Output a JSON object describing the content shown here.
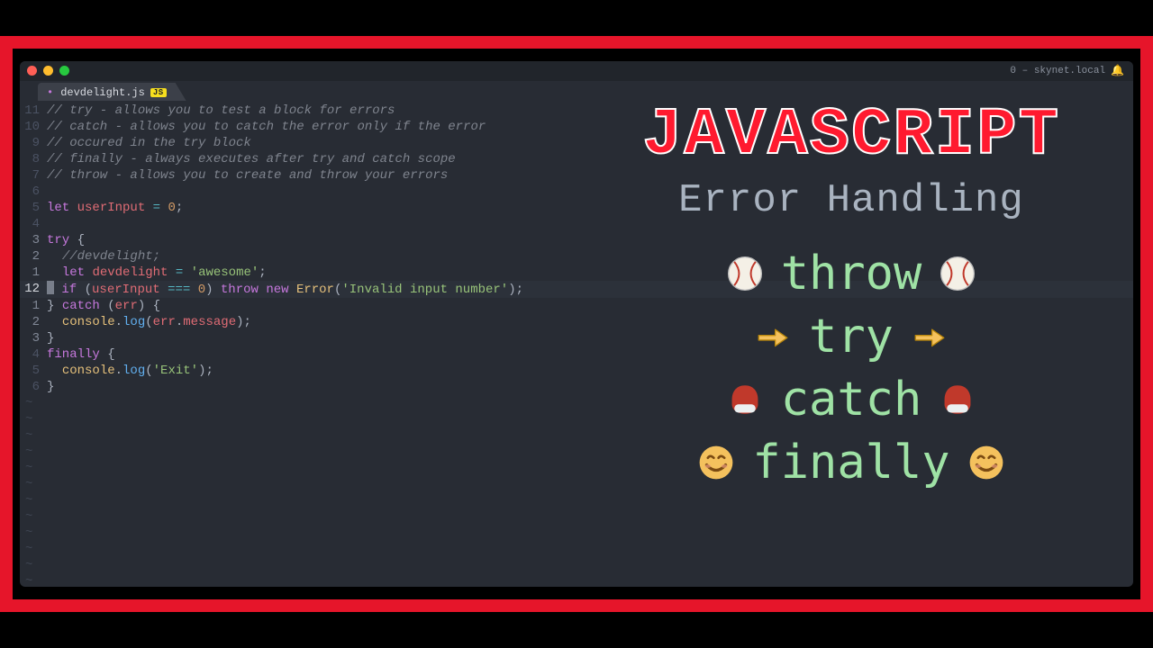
{
  "titlebar": {
    "status_right": "0 – skynet.local",
    "bell_icon": "🔔"
  },
  "tab": {
    "modified_marker": "•",
    "filename": "devdelight.js",
    "lang_badge": "JS"
  },
  "code_lines": [
    {
      "n": "11",
      "cls": "",
      "html": "<span class='tok-comment'>// try - allows you to test a block for errors</span>"
    },
    {
      "n": "10",
      "cls": "",
      "html": "<span class='tok-comment'>// catch - allows you to catch the error only if the error</span>"
    },
    {
      "n": "9",
      "cls": "",
      "html": "<span class='tok-comment'>// occured in the try block</span>"
    },
    {
      "n": "8",
      "cls": "",
      "html": "<span class='tok-comment'>// finally - always executes after try and catch scope</span>"
    },
    {
      "n": "7",
      "cls": "",
      "html": "<span class='tok-comment'>// throw - allows you to create and throw your errors</span>"
    },
    {
      "n": "6",
      "cls": "",
      "html": ""
    },
    {
      "n": "5",
      "cls": "",
      "html": "<span class='tok-keyword'>let</span> <span class='tok-ident'>userInput</span> <span class='tok-op'>=</span> <span class='tok-num'>0</span><span class='tok-punc'>;</span>"
    },
    {
      "n": "4",
      "cls": "",
      "html": ""
    },
    {
      "n": "3",
      "cls": "near",
      "html": "<span class='tok-keyword'>try</span> <span class='tok-punc'>{</span>"
    },
    {
      "n": "2",
      "cls": "near",
      "html": "  <span class='tok-comment'>//devdelight;</span>"
    },
    {
      "n": "1",
      "cls": "near",
      "html": "  <span class='tok-keyword'>let</span> <span class='tok-ident'>devdelight</span> <span class='tok-op'>=</span> <span class='tok-string'>'awesome'</span><span class='tok-punc'>;</span>"
    },
    {
      "n": "12",
      "cls": "cursor",
      "current": true,
      "html": "<span class='cursorblock'></span> <span class='tok-keyword'>if</span> <span class='tok-punc'>(</span><span class='tok-ident'>userInput</span> <span class='tok-op'>===</span> <span class='tok-num'>0</span><span class='tok-punc'>)</span> <span class='tok-keyword'>throw</span> <span class='tok-keyword'>new</span> <span class='tok-ident2'>Error</span><span class='tok-punc'>(</span><span class='tok-string'>'Invalid input number'</span><span class='tok-punc'>);</span>"
    },
    {
      "n": "1",
      "cls": "near",
      "html": "<span class='tok-punc'>}</span> <span class='tok-keyword'>catch</span> <span class='tok-punc'>(</span><span class='tok-ident'>err</span><span class='tok-punc'>)</span> <span class='tok-punc'>{</span>"
    },
    {
      "n": "2",
      "cls": "near",
      "html": "  <span class='tok-ident2'>console</span><span class='tok-punc'>.</span><span class='tok-func'>log</span><span class='tok-punc'>(</span><span class='tok-ident'>err</span><span class='tok-punc'>.</span><span class='tok-ident'>message</span><span class='tok-punc'>);</span>"
    },
    {
      "n": "3",
      "cls": "near",
      "html": "<span class='tok-punc'>}</span>"
    },
    {
      "n": "4",
      "cls": "",
      "html": "<span class='tok-keyword'>finally</span> <span class='tok-punc'>{</span>"
    },
    {
      "n": "5",
      "cls": "",
      "html": "  <span class='tok-ident2'>console</span><span class='tok-punc'>.</span><span class='tok-func'>log</span><span class='tok-punc'>(</span><span class='tok-string'>'Exit'</span><span class='tok-punc'>);</span>"
    },
    {
      "n": "6",
      "cls": "",
      "html": "<span class='tok-punc'>}</span>"
    }
  ],
  "tilde_count": 14,
  "overlay": {
    "title": "JAVASCRIPT",
    "subtitle": "Error Handling",
    "rows": [
      {
        "emoji": "baseball",
        "word": "throw"
      },
      {
        "emoji": "point",
        "word": "try"
      },
      {
        "emoji": "mitt",
        "word": "catch"
      },
      {
        "emoji": "smile",
        "word": "finally"
      }
    ]
  }
}
